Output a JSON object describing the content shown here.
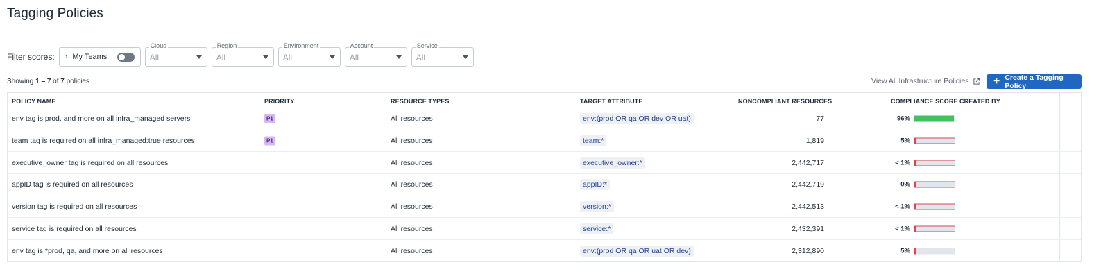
{
  "page": {
    "title": "Tagging Policies"
  },
  "filters": {
    "label": "Filter scores:",
    "my_teams": "My Teams",
    "selects": [
      {
        "label": "Cloud",
        "value": "All"
      },
      {
        "label": "Region",
        "value": "All"
      },
      {
        "label": "Environment",
        "value": "All"
      },
      {
        "label": "Account",
        "value": "All"
      },
      {
        "label": "Service",
        "value": "All"
      }
    ]
  },
  "summary": {
    "prefix": "Showing ",
    "range": "1 – 7",
    "mid": " of ",
    "total": "7",
    "suffix": " policies"
  },
  "actions": {
    "view_all": "View All Infrastructure Policies",
    "create": "Create a Tagging Policy"
  },
  "colors": {
    "primary": "#1f67c3",
    "good": "#3fc25f",
    "bad": "#e0424e",
    "track": "#e1e5ee"
  },
  "table": {
    "columns": [
      "POLICY NAME",
      "PRIORITY",
      "RESOURCE TYPES",
      "TARGET ATTRIBUTE",
      "NONCOMPLIANT RESOURCES",
      "COMPLIANCE SCORE",
      "CREATED BY"
    ],
    "rows": [
      {
        "name": "env tag is prod, and more on all infra_managed servers",
        "priority": "P1",
        "resource_types": "All resources",
        "target": "env:(prod OR qa OR dev OR uat)",
        "noncompliant": "77",
        "score": "96%",
        "score_value": 0.96,
        "status": "good"
      },
      {
        "name": "team tag is required on all infra_managed:true resources",
        "priority": "P1",
        "resource_types": "All resources",
        "target": "team:*",
        "noncompliant": "1,819",
        "score": "5%",
        "score_value": 0.05,
        "status": "bad"
      },
      {
        "name": "executive_owner tag is required on all resources",
        "priority": "",
        "resource_types": "All resources",
        "target": "executive_owner:*",
        "noncompliant": "2,442,717",
        "score": "< 1%",
        "score_value": 0.005,
        "status": "bad"
      },
      {
        "name": "appID tag is required on all resources",
        "priority": "",
        "resource_types": "All resources",
        "target": "appID:*",
        "noncompliant": "2,442,719",
        "score": "0%",
        "score_value": 0,
        "status": "bad"
      },
      {
        "name": "version tag is required on all resources",
        "priority": "",
        "resource_types": "All resources",
        "target": "version:*",
        "noncompliant": "2,442,513",
        "score": "< 1%",
        "score_value": 0.005,
        "status": "bad"
      },
      {
        "name": "service tag is required on all resources",
        "priority": "",
        "resource_types": "All resources",
        "target": "service:*",
        "noncompliant": "2,432,391",
        "score": "< 1%",
        "score_value": 0.005,
        "status": "bad"
      },
      {
        "name": "env tag is *prod, qa, and more on all resources",
        "priority": "",
        "resource_types": "All resources",
        "target": "env:(prod OR qa OR uat OR dev)",
        "noncompliant": "2,312,890",
        "score": "5%",
        "score_value": 0.05,
        "status": "partial"
      }
    ]
  }
}
